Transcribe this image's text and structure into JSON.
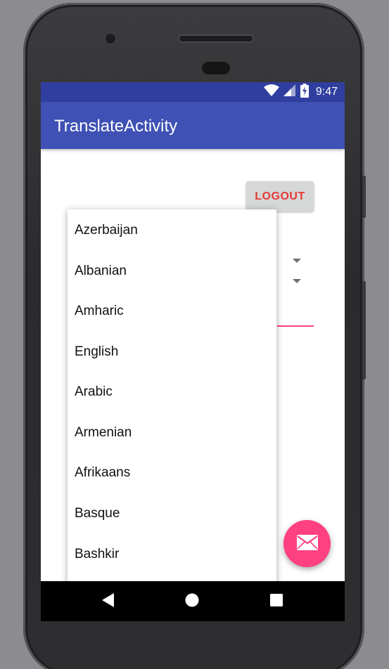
{
  "status_bar": {
    "time": "9:47",
    "icons": [
      "wifi-icon",
      "cell-signal-icon",
      "battery-charging-icon"
    ]
  },
  "app_bar": {
    "title": "TranslateActivity"
  },
  "content": {
    "logout_label": "LOGOUT"
  },
  "dropdown": {
    "items": [
      {
        "label": "Azerbaijan"
      },
      {
        "label": "Albanian"
      },
      {
        "label": "Amharic"
      },
      {
        "label": "English"
      },
      {
        "label": "Arabic"
      },
      {
        "label": "Armenian"
      },
      {
        "label": "Afrikaans"
      },
      {
        "label": "Basque"
      },
      {
        "label": "Bashkir"
      }
    ]
  },
  "fab": {
    "icon": "email-icon"
  },
  "nav_bar": {
    "icons": [
      "back-icon",
      "home-icon",
      "recents-icon"
    ]
  },
  "colors": {
    "primary": "#3f51b5",
    "primary_dark": "#303f9f",
    "accent": "#ff4081",
    "logout_text": "#e53935"
  }
}
